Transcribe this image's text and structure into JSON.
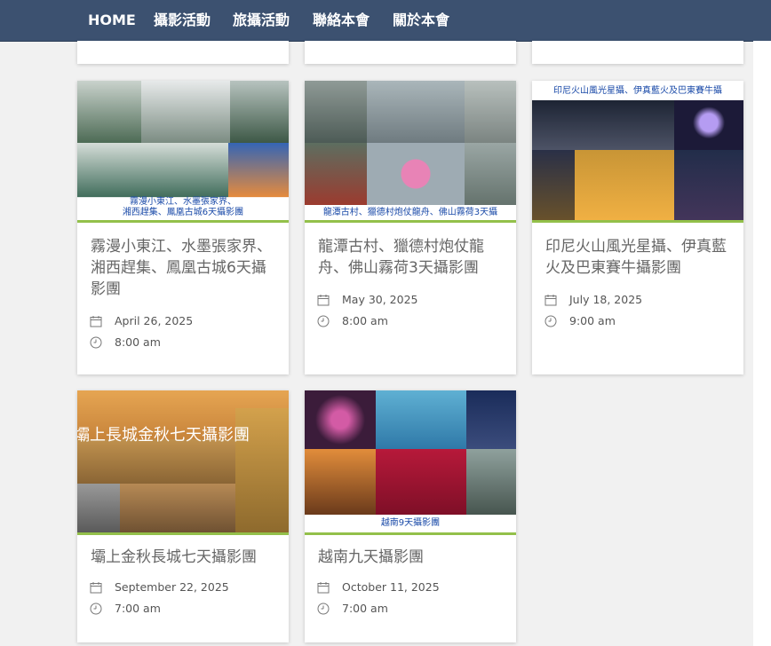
{
  "nav": {
    "items": [
      "HOME",
      "攝影活動",
      "旅攝活動",
      "聯絡本會",
      "關於本會"
    ]
  },
  "events": [
    {
      "thumb_caption_1": "霧漫小東江、水墨張家界、",
      "thumb_caption_2": "湘西趕集、鳳凰古城6天攝影團",
      "title": "霧漫小東江、水墨張家界、湘西趕集、鳳凰古城6天攝影團",
      "date": "April 26, 2025",
      "time": "8:00 am"
    },
    {
      "thumb_caption_1": "龍潭古村、獵德村炮仗龍舟、佛山霧荷3天攝",
      "title": "龍潭古村、獵德村炮仗龍舟、佛山霧荷3天攝影團",
      "date": "May 30, 2025",
      "time": "8:00 am"
    },
    {
      "thumb_caption_1": "印尼火山風光星攝、伊真藍火及巴東賽牛攝",
      "title": "印尼火山風光星攝、伊真藍火及巴東賽牛攝影團",
      "date": "July 18, 2025",
      "time": "9:00 am"
    },
    {
      "thumb_caption_1": "壩上長城金秋七天攝影團",
      "title": "壩上金秋長城七天攝影團",
      "date": "September 22, 2025",
      "time": "7:00 am"
    },
    {
      "thumb_caption_1": "越南9天攝影團",
      "title": "越南九天攝影團",
      "date": "October 11, 2025",
      "time": "7:00 am"
    }
  ],
  "icons": {
    "date": "calendar-icon",
    "time": "clock-icon"
  },
  "colors": {
    "nav_bg": "#3c5170",
    "accent_line": "#93c04a",
    "title_text": "#666666"
  }
}
